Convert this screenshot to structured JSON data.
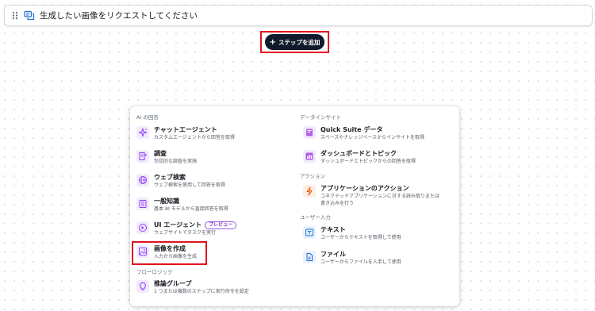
{
  "step": {
    "title": "生成したい画像をリクエストしてください",
    "drag_icon": "drag-handle-icon",
    "step_icon": "chat-bubble-icon"
  },
  "add_step": {
    "label": "ステップを追加",
    "icon": "plus-icon"
  },
  "menu": {
    "left_sections": [
      {
        "title": "AI の回答",
        "items": [
          {
            "label": "チャットエージェント",
            "desc": "カスタムエージェントから回答を取得",
            "icon": "sparkle-icon"
          },
          {
            "label": "調査",
            "desc": "包括的な調査を実施",
            "icon": "research-icon"
          },
          {
            "label": "ウェブ検索",
            "desc": "ウェブ検索を使用して回答を取得",
            "icon": "globe-icon"
          },
          {
            "label": "一般知識",
            "desc": "基本 AI モデルから直接回答を取得",
            "icon": "knowledge-icon"
          },
          {
            "label": "UI エージェント",
            "badge": "プレビュー",
            "desc": "ウェブサイトでタスクを実行",
            "icon": "ui-agent-icon"
          },
          {
            "label": "画像を作成",
            "desc": "入力から画像を生成",
            "icon": "image-icon"
          }
        ]
      },
      {
        "title": "フローロジック",
        "items": [
          {
            "label": "推論グループ",
            "desc": "1 つまたは複数のステップに実行命令を設定",
            "icon": "lightbulb-icon"
          }
        ]
      }
    ],
    "right_sections": [
      {
        "title": "データインサイト",
        "items": [
          {
            "label": "Quick Suite データ",
            "desc": "スペースやナレッジベースからインサイトを取得",
            "icon": "data-book-icon"
          },
          {
            "label": "ダッシュボードとトピック",
            "desc": "ダッシュボードとトピックからの回答を取得",
            "icon": "dashboard-icon"
          }
        ]
      },
      {
        "title": "アクション",
        "items": [
          {
            "label": "アプリケーションのアクション",
            "desc_lines": [
              "コネクテッドアプリケーションに対する読み取りまたは",
              "書き込みを行う"
            ],
            "icon": "lightning-icon"
          }
        ]
      },
      {
        "title": "ユーザー入力",
        "items": [
          {
            "label": "テキスト",
            "desc": "ユーザーからテキストを取得して使用",
            "icon": "text-input-icon"
          },
          {
            "label": "ファイル",
            "desc": "ユーザーからファイルを入手して使用",
            "icon": "file-icon"
          }
        ]
      }
    ]
  },
  "colors": {
    "purple": "#8a3ffc",
    "orange": "#e8590c",
    "blue": "#1f6fd1",
    "highlight": "#e0141e",
    "button": "#0f1b2a"
  }
}
